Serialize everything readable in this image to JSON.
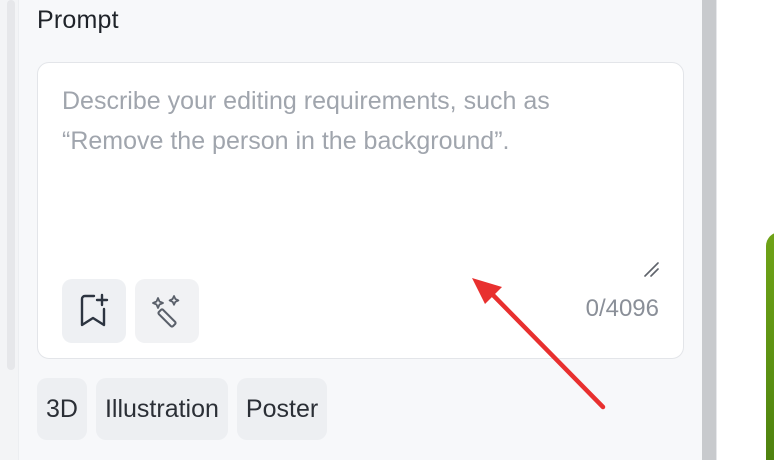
{
  "prompt_section": {
    "title": "Prompt",
    "placeholder": "Describe your editing requirements, such as “Remove the person in the background”.",
    "value": "",
    "char_count": "0/4096"
  },
  "tools": [
    {
      "icon": "bookmark-add-icon"
    },
    {
      "icon": "magic-wand-icon"
    }
  ],
  "tags": [
    {
      "label": "3D"
    },
    {
      "label": "Illustration"
    },
    {
      "label": "Poster"
    }
  ],
  "annotation": {
    "color": "#e8302f"
  }
}
